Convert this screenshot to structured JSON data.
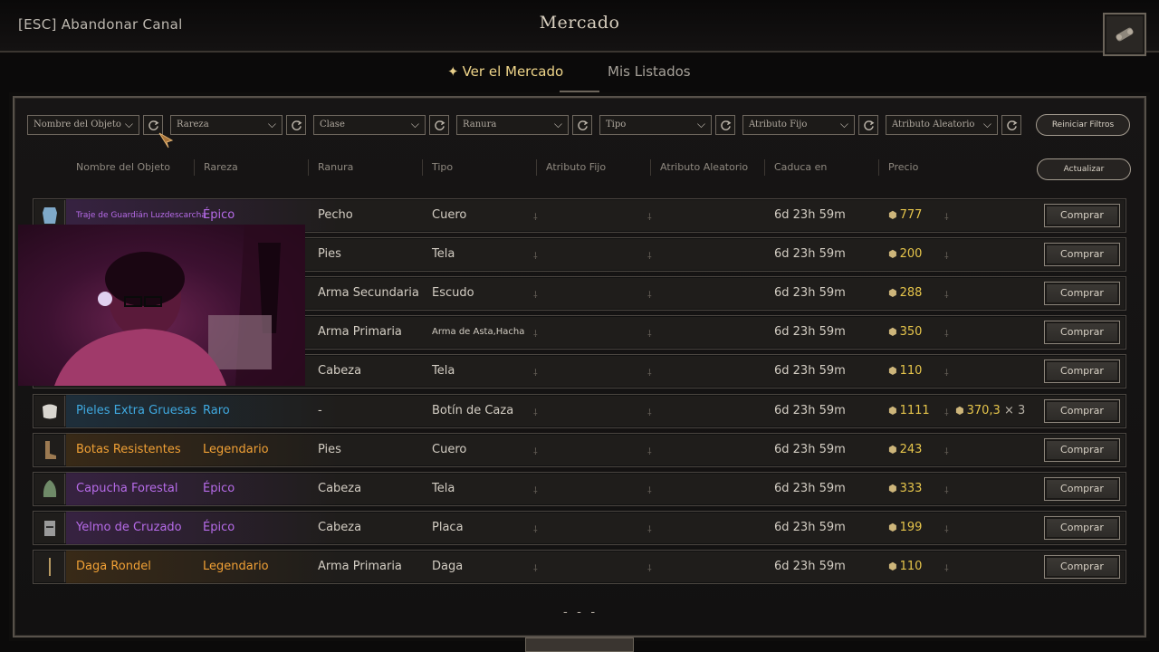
{
  "header": {
    "esc_label": "[ESC] Abandonar Canal",
    "title": "Mercado"
  },
  "tabs": {
    "active": "Ver el Mercado",
    "inactive": "Mis Listados"
  },
  "filters": {
    "name": "Nombre del Objeto",
    "rarity": "Rareza",
    "class": "Clase",
    "slot": "Ranura",
    "type": "Tipo",
    "fixed_attr": "Atributo Fijo",
    "random_attr": "Atributo Aleatorio",
    "reset": "Reiniciar Filtros"
  },
  "columns": {
    "name": "Nombre del Objeto",
    "rarity": "Rareza",
    "slot": "Ranura",
    "type": "Tipo",
    "fixed_attr": "Atributo Fijo",
    "random_attr": "Atributo Aleatorio",
    "expires": "Caduca en",
    "price": "Precio",
    "refresh": "Actualizar"
  },
  "rows": [
    {
      "name": "Traje de Guardián Luzdescarcha",
      "rarity": "Épico",
      "slot": "Pecho",
      "type": "Cuero",
      "expires": "6d 23h 59m",
      "price": "777",
      "extra": "",
      "mult": ""
    },
    {
      "name": "",
      "rarity": "",
      "slot": "Pies",
      "type": "Tela",
      "expires": "6d 23h 59m",
      "price": "200",
      "extra": "",
      "mult": ""
    },
    {
      "name": "",
      "rarity": "",
      "slot": "Arma Secundaria",
      "type": "Escudo",
      "expires": "6d 23h 59m",
      "price": "288",
      "extra": "",
      "mult": ""
    },
    {
      "name": "",
      "rarity": "",
      "slot": "Arma Primaria",
      "type": "Arma de Asta,Hacha",
      "expires": "6d 23h 59m",
      "price": "350",
      "extra": "",
      "mult": ""
    },
    {
      "name": "",
      "rarity": "",
      "slot": "Cabeza",
      "type": "Tela",
      "expires": "6d 23h 59m",
      "price": "110",
      "extra": "",
      "mult": ""
    },
    {
      "name": "Pieles Extra Gruesas",
      "rarity": "Raro",
      "slot": "-",
      "type": "Botín de Caza",
      "expires": "6d 23h 59m",
      "price": "1111",
      "extra": "370,3",
      "mult": "× 3"
    },
    {
      "name": "Botas Resistentes",
      "rarity": "Legendario",
      "slot": "Pies",
      "type": "Cuero",
      "expires": "6d 23h 59m",
      "price": "243",
      "extra": "",
      "mult": ""
    },
    {
      "name": "Capucha Forestal",
      "rarity": "Épico",
      "slot": "Cabeza",
      "type": "Tela",
      "expires": "6d 23h 59m",
      "price": "333",
      "extra": "",
      "mult": ""
    },
    {
      "name": "Yelmo de Cruzado",
      "rarity": "Épico",
      "slot": "Cabeza",
      "type": "Placa",
      "expires": "6d 23h 59m",
      "price": "199",
      "extra": "",
      "mult": ""
    },
    {
      "name": "Daga Rondel",
      "rarity": "Legendario",
      "slot": "Arma Primaria",
      "type": "Daga",
      "expires": "6d 23h 59m",
      "price": "110",
      "extra": "",
      "mult": ""
    }
  ],
  "buy_label": "Comprar",
  "pager": "- - -",
  "colors": {
    "epic": "#b66be8",
    "rare": "#3fa9e0",
    "legendary": "#f0a035",
    "gold": "#e6c54b"
  },
  "icons": {
    "row_icons": [
      "armor-icon",
      "boots-icon",
      "shield-icon",
      "axe-icon",
      "hood-icon",
      "hide-icon",
      "boots-icon",
      "hood-icon",
      "helmet-icon",
      "dagger-icon"
    ]
  }
}
